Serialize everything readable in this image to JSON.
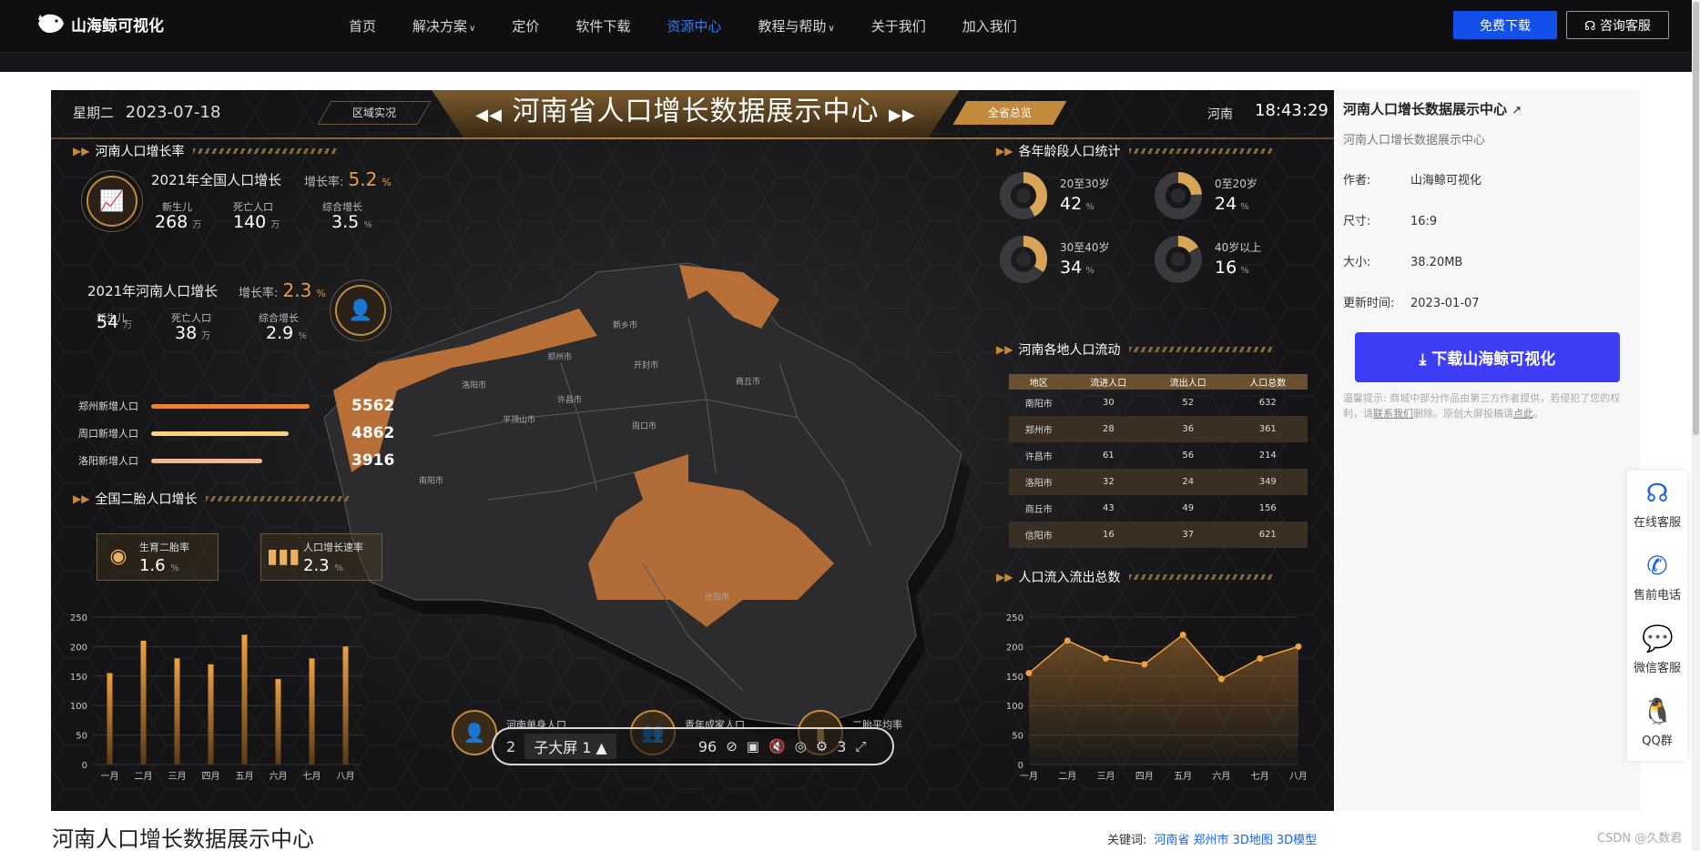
{
  "nav": {
    "logo": "山海鲸可视化",
    "items": [
      {
        "label": "首页",
        "chevron": false,
        "active": false
      },
      {
        "label": "解决方案",
        "chevron": true,
        "active": false
      },
      {
        "label": "定价",
        "chevron": false,
        "active": false
      },
      {
        "label": "软件下载",
        "chevron": false,
        "active": false
      },
      {
        "label": "资源中心",
        "chevron": false,
        "active": true
      },
      {
        "label": "教程与帮助",
        "chevron": true,
        "active": false
      },
      {
        "label": "关于我们",
        "chevron": false,
        "active": false
      },
      {
        "label": "加入我们",
        "chevron": false,
        "active": false
      }
    ],
    "btn_free": "免费下载",
    "btn_consult": "咨询客服"
  },
  "dashboard": {
    "weekday": "星期二",
    "date": "2023-07-18",
    "tab_left": "区域实况",
    "title": "河南省人口增长数据展示中心",
    "tab_right": "全省总览",
    "region": "河南",
    "time": "18:43:29",
    "growth_panel": {
      "title": "河南人口增长率",
      "national": {
        "heading": "2021年全国人口增长",
        "rate_label": "增长率:",
        "rate": "5.2",
        "rate_unit": "%",
        "births_label": "新生儿",
        "births": "268",
        "deaths_label": "死亡人口",
        "deaths": "140",
        "total_label": "综合增长",
        "total": "3.5",
        "unit_wan": "万",
        "unit_pct": "%"
      },
      "henan": {
        "heading": "2021年河南人口增长",
        "rate_label": "增长率:",
        "rate": "2.3",
        "rate_unit": "%",
        "births_label": "新生儿",
        "births": "54",
        "deaths_label": "死亡人口",
        "deaths": "38",
        "total_label": "综合增长",
        "total": "2.9",
        "unit_wan": "万",
        "unit_pct": "%"
      },
      "bars": [
        {
          "label": "郑州新增人口",
          "value": "5562",
          "fraction": 1.0,
          "color": "#e8843a"
        },
        {
          "label": "周口新增人口",
          "value": "4862",
          "fraction": 0.87,
          "color": "#f5d48a"
        },
        {
          "label": "洛阳新增人口",
          "value": "3916",
          "fraction": 0.7,
          "color": "#f0b89a"
        }
      ]
    },
    "second_child": {
      "title": "全国二胎人口增长",
      "box1_label": "生育二胎率",
      "box1_value": "1.6",
      "box1_unit": "%",
      "box2_label": "人口增长速率",
      "box2_value": "2.3",
      "box2_unit": "%"
    },
    "age_panel": {
      "title": "各年龄段人口统计",
      "items": [
        {
          "label": "20至30岁",
          "value": "42",
          "unit": "%",
          "pct": 42
        },
        {
          "label": "0至20岁",
          "value": "24",
          "unit": "%",
          "pct": 24
        },
        {
          "label": "30至40岁",
          "value": "34",
          "unit": "%",
          "pct": 34
        },
        {
          "label": "40岁以上",
          "value": "16",
          "unit": "%",
          "pct": 16
        }
      ]
    },
    "flow_panel": {
      "title": "河南各地人口流动",
      "headers": [
        "地区",
        "流进人口",
        "流出人口",
        "人口总数"
      ],
      "rows": [
        [
          "南阳市",
          "30",
          "52",
          "632"
        ],
        [
          "郑州市",
          "28",
          "36",
          "361"
        ],
        [
          "许昌市",
          "61",
          "56",
          "214"
        ],
        [
          "洛阳市",
          "32",
          "24",
          "349"
        ],
        [
          "商丘市",
          "43",
          "49",
          "156"
        ],
        [
          "信阳市",
          "16",
          "37",
          "621"
        ]
      ]
    },
    "inout_panel": {
      "title": "人口流入流出总数"
    },
    "map_cities": [
      {
        "name": "郑州市"
      },
      {
        "name": "开封市"
      },
      {
        "name": "商丘市"
      },
      {
        "name": "许昌市"
      },
      {
        "name": "周口市"
      },
      {
        "name": "南阳市"
      },
      {
        "name": "信阳市"
      },
      {
        "name": "新乡市"
      },
      {
        "name": "洛阳市"
      },
      {
        "name": "平顶山市"
      }
    ],
    "bottom": [
      {
        "label": "河南单身人口"
      },
      {
        "label": "青年成家人口"
      },
      {
        "label": "二胎平均率"
      }
    ],
    "toolbar": {
      "left_num": "2",
      "select": "子大屏 1 ▲",
      "fps": "96",
      "right_num": "3"
    }
  },
  "chart_data": [
    {
      "type": "bar",
      "categories": [
        "一月",
        "二月",
        "三月",
        "四月",
        "五月",
        "六月",
        "七月",
        "八月"
      ],
      "values": [
        155,
        210,
        180,
        170,
        220,
        145,
        180,
        200
      ],
      "ylim": [
        0,
        250
      ],
      "yticks": [
        0,
        50,
        100,
        150,
        200,
        250
      ],
      "color": "#e8963c"
    },
    {
      "type": "area",
      "categories": [
        "一月",
        "二月",
        "三月",
        "四月",
        "五月",
        "六月",
        "七月",
        "八月"
      ],
      "values": [
        155,
        210,
        180,
        170,
        220,
        145,
        180,
        200
      ],
      "ylim": [
        0,
        250
      ],
      "yticks": [
        0,
        50,
        100,
        150,
        200,
        250
      ],
      "color": "#f0a040"
    }
  ],
  "info": {
    "title": "河南人口增长数据展示中心",
    "subtitle": "河南人口增长数据展示中心",
    "author_label": "作者:",
    "author": "山海鲸可视化",
    "size_label": "尺寸:",
    "size": "16:9",
    "filesize_label": "大小:",
    "filesize": "38.20MB",
    "updated_label": "更新时间:",
    "updated": "2023-01-07",
    "download": "下载山海鲸可视化",
    "note_prefix": "温馨提示:",
    "note": "商城中部分作品由第三方作者提供，若侵犯了您的权利，请",
    "note_link1": "联系我们",
    "note_mid": "删除。原创大屏投稿请",
    "note_link2": "点此",
    "note_end": "。"
  },
  "service": [
    {
      "label": "在线客服",
      "icon": "headset-icon"
    },
    {
      "label": "售前电话",
      "icon": "phone-icon"
    },
    {
      "label": "微信客服",
      "icon": "wechat-icon"
    },
    {
      "label": "QQ群",
      "icon": "qq-icon"
    }
  ],
  "below": {
    "title": "河南人口增长数据展示中心",
    "kw_label": "关键词:",
    "keywords": [
      "河南省",
      "郑州市",
      "3D地图",
      "3D模型"
    ],
    "watermark": "CSDN @久数君"
  }
}
